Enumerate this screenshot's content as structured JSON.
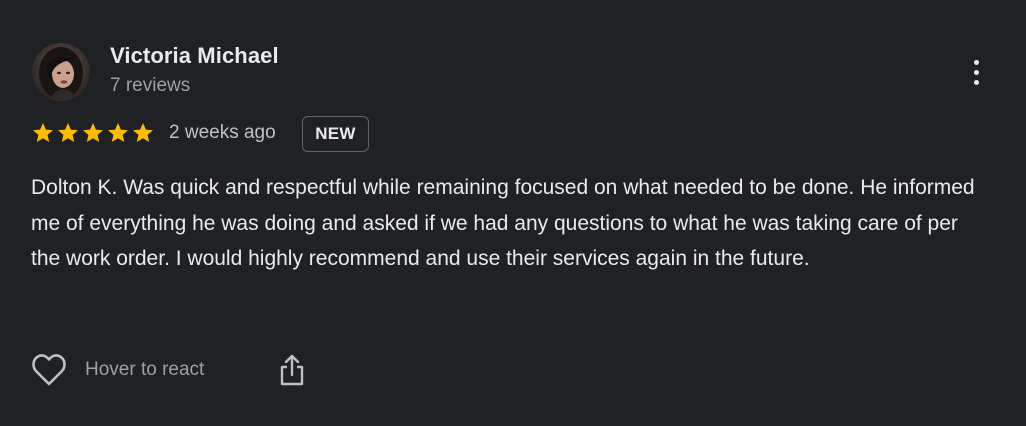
{
  "review": {
    "reviewer": {
      "name": "Victoria Michael",
      "review_count": "7 reviews"
    },
    "rating": 5,
    "rating_max": 5,
    "time": "2 weeks ago",
    "badge": "NEW",
    "text": "Dolton K. Was quick and respectful while remaining focused on what needed to be done. He informed me of everything he was doing and asked if we had any questions to what he was taking care of per the work order. I would highly recommend and use their services again in the future."
  },
  "actions": {
    "react_label": "Hover to react",
    "react_icon": "heart-icon",
    "share_icon": "share-icon",
    "more_icon": "more-vertical-icon"
  },
  "colors": {
    "background": "#202124",
    "star": "#fbbc04",
    "text_primary": "#e8eaed",
    "text_secondary": "#9aa0a6"
  }
}
